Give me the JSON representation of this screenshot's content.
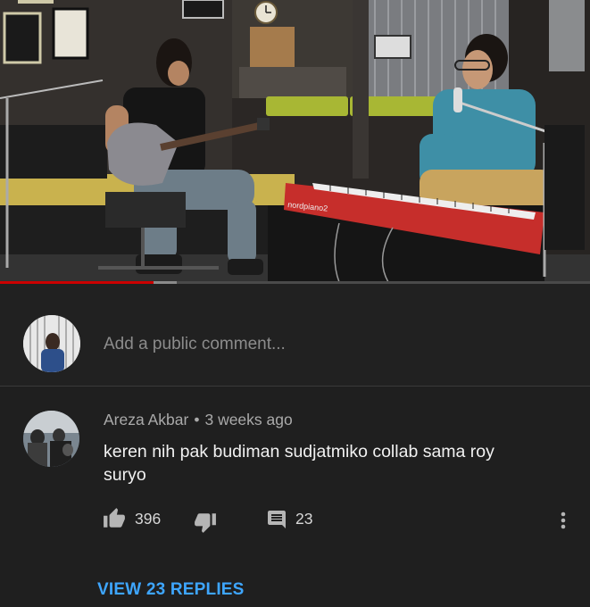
{
  "video": {
    "progress_fraction": 0.26,
    "buffer_fraction": 0.04,
    "keyboard_brand": "nordpiano2",
    "icons": [
      "video-scene"
    ]
  },
  "comment_box": {
    "placeholder": "Add a public comment..."
  },
  "comment": {
    "author": "Areza Akbar",
    "separator": "•",
    "time": "3 weeks ago",
    "text": "keren nih pak budiman sudjatmiko collab sama roy suryo",
    "likes": "396",
    "replies": "23",
    "view_replies_label": "VIEW 23 REPLIES",
    "icons": [
      "thumbs-up-icon",
      "thumbs-down-icon",
      "reply-icon",
      "more-vertical-icon"
    ]
  },
  "colors": {
    "background": "#1f1f1f",
    "accent_link": "#3ea6ff",
    "progress": "#cc0000",
    "muted_text": "#aaaaaa"
  }
}
